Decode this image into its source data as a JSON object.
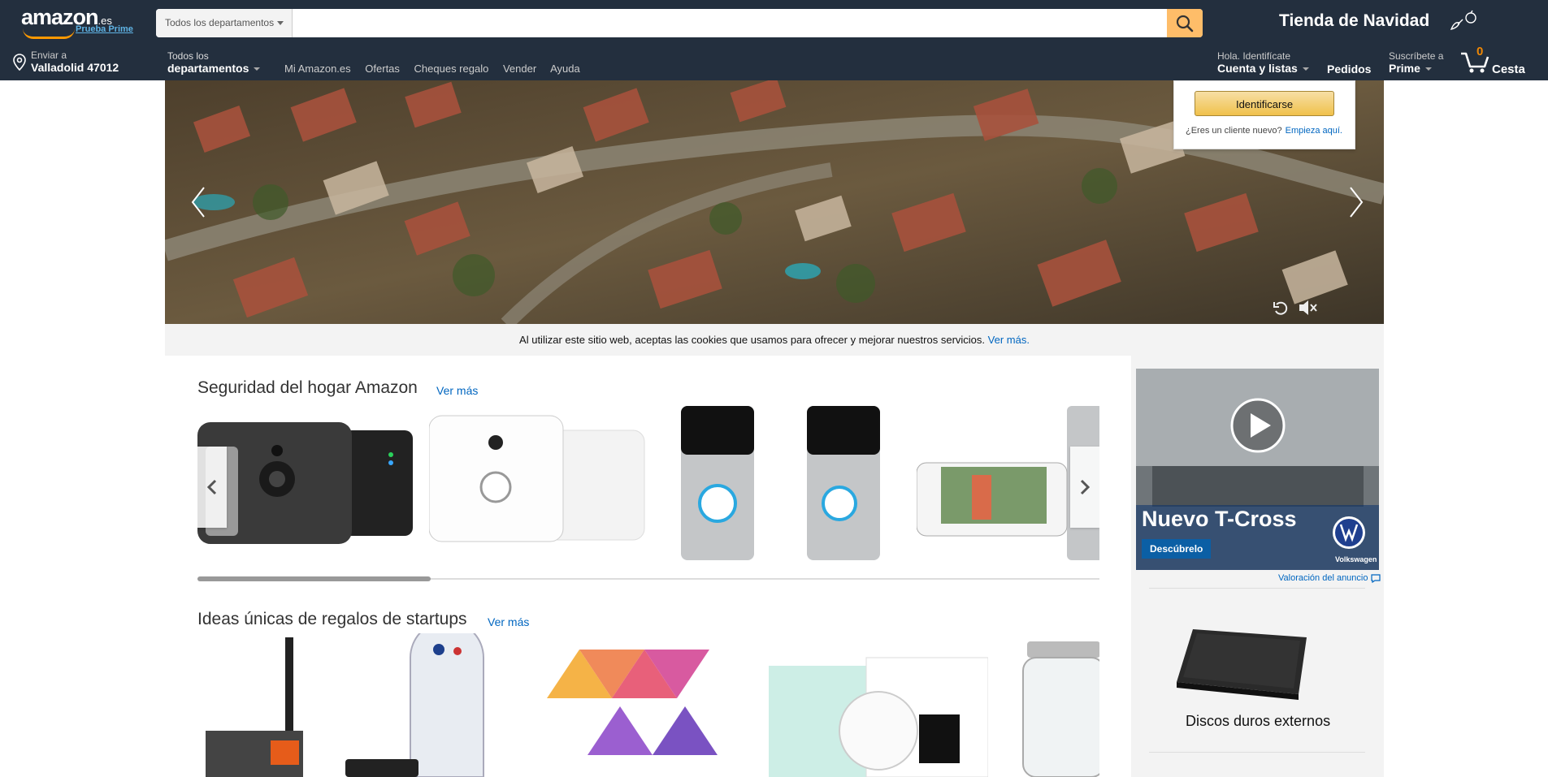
{
  "header": {
    "logo_text": "amazon",
    "logo_tld": ".es",
    "prime_link": "Prueba Prime",
    "search": {
      "department": "Todos los departamentos",
      "placeholder": ""
    },
    "holiday_label": "Tienda de Navidad"
  },
  "nav": {
    "location_line1": "Enviar a",
    "location_line2": "Valladolid 47012",
    "alldept_line1": "Todos los",
    "alldept_line2": "departamentos",
    "links": [
      "Mi Amazon.es",
      "Ofertas",
      "Cheques regalo",
      "Vender",
      "Ayuda"
    ],
    "account_line1": "Hola. Identifícate",
    "account_line2": "Cuenta y listas",
    "orders": "Pedidos",
    "prime_line1": "Suscríbete a",
    "prime_line2": "Prime",
    "cart_count": "0",
    "cart_label": "Cesta"
  },
  "signin_flyout": {
    "button": "Identificarse",
    "new_customer": "¿Eres un cliente nuevo?",
    "start_link": "Empieza aquí."
  },
  "cookie_bar": {
    "text": "Al utilizar este sitio web, aceptas las cookies que usamos para ofrecer y mejorar nuestros servicios.",
    "link": "Ver más."
  },
  "shelves": [
    {
      "title": "Seguridad del hogar Amazon",
      "more": "Ver más"
    },
    {
      "title": "Ideas únicas de regalos de startups",
      "more": "Ver más"
    }
  ],
  "ad": {
    "headline": "Nuevo T-Cross",
    "cta": "Descúbrelo",
    "brand": "Volkswagen",
    "feedback": "Valoración del anuncio"
  },
  "sidebar_card": {
    "label": "Discos duros externos"
  },
  "colors": {
    "nav_bg": "#232f3e",
    "search_btn": "#febd69",
    "link": "#0066c0",
    "accent": "#f90"
  }
}
